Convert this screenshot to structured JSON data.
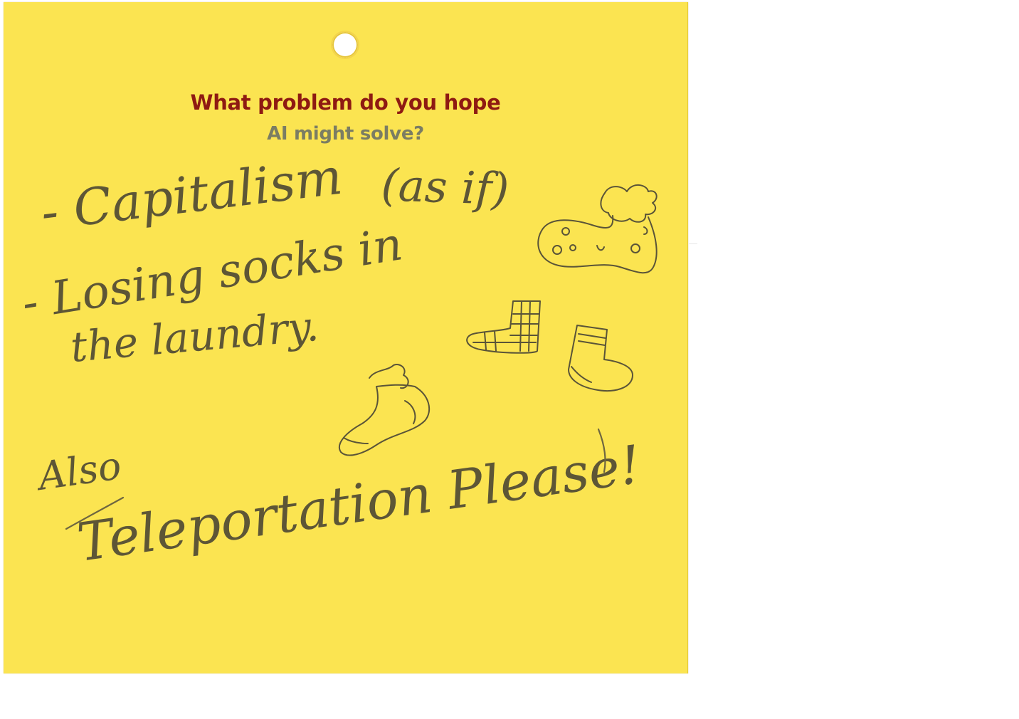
{
  "card": {
    "title_line1": "What problem do you hope",
    "title_line2": "AI might solve?",
    "handwriting": {
      "line1_a": "- Capitalism",
      "line1_b": "(as if)",
      "line2": "- Losing socks in",
      "line3": "the laundry.",
      "line4": "Also",
      "line5": "Teleportation Please!"
    },
    "drawings": [
      "sock-doodle",
      "sock-doodle",
      "sock-doodle",
      "sock-doodle"
    ],
    "colors": {
      "card": "#fbe451",
      "title_primary": "#8e1a12",
      "title_secondary": "#7b7d63",
      "ink": "#5d5636"
    }
  }
}
